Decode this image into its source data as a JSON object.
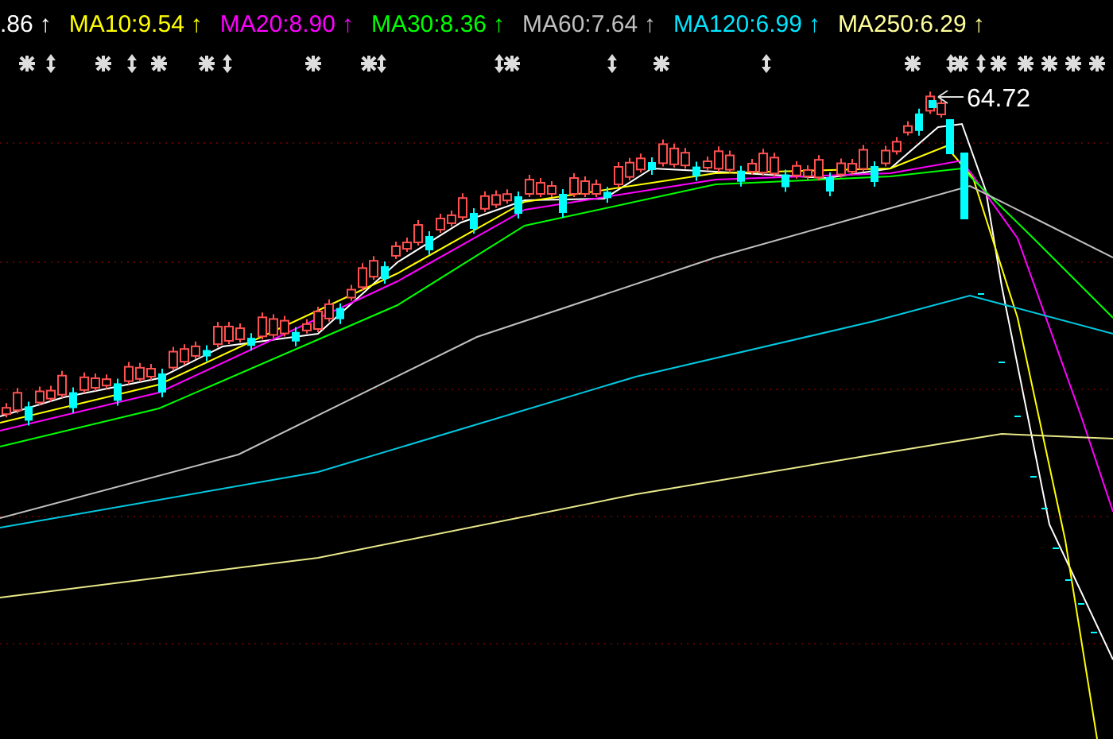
{
  "legend": [
    {
      "text": ".86",
      "arrow": "↑",
      "color": "#ffffff"
    },
    {
      "text": "MA10:9.54",
      "arrow": "↑",
      "color": "#ffff00"
    },
    {
      "text": "MA20:8.90",
      "arrow": "↑",
      "color": "#ff00ff"
    },
    {
      "text": "MA30:8.36",
      "arrow": "↑",
      "color": "#00ff00"
    },
    {
      "text": "MA60:7.64",
      "arrow": "↑",
      "color": "#c0c0c0"
    },
    {
      "text": "MA120:6.99",
      "arrow": "↑",
      "color": "#00e5ff"
    },
    {
      "text": "MA250:6.29",
      "arrow": "↑",
      "color": "#ffff99"
    }
  ],
  "peak_label": "64.72"
}
